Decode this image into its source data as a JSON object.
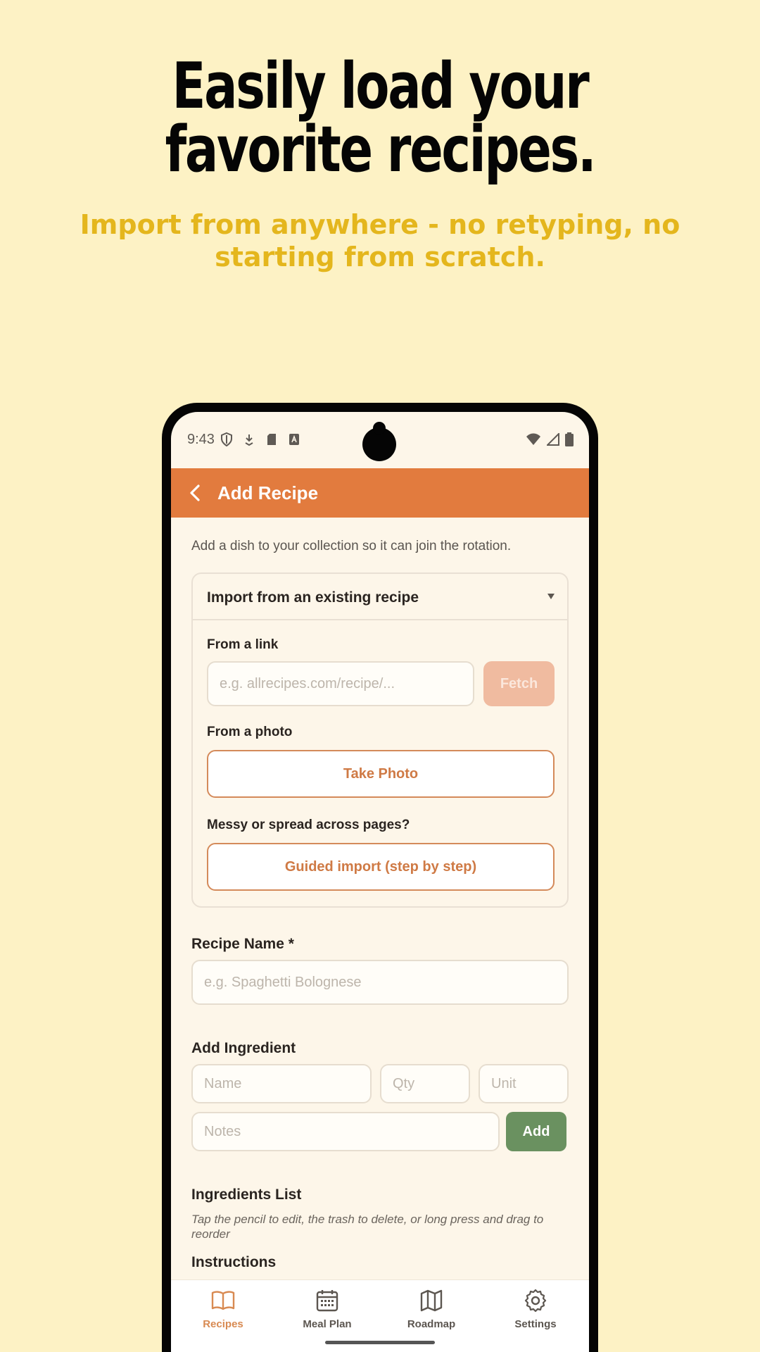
{
  "promo": {
    "headline": "Easily load your favorite recipes.",
    "subline": "Import from anywhere - no retyping, no starting from scratch."
  },
  "status": {
    "time": "9:43",
    "icons_left": [
      "shield-icon",
      "download-icon",
      "sd-card-icon",
      "font-a-icon"
    ],
    "icons_right": [
      "wifi-icon",
      "signal-icon",
      "battery-icon"
    ]
  },
  "appbar": {
    "title": "Add Recipe",
    "back_icon": "chevron-left-icon"
  },
  "intro": "Add a dish to your collection so it can join the rotation.",
  "import": {
    "title": "Import from an existing recipe",
    "link_label": "From a link",
    "link_placeholder": "e.g. allrecipes.com/recipe/...",
    "fetch_label": "Fetch",
    "photo_label": "From a photo",
    "photo_button": "Take Photo",
    "guided_label": "Messy or spread across pages?",
    "guided_button": "Guided import (step by step)"
  },
  "recipe_name": {
    "label": "Recipe Name *",
    "placeholder": "e.g. Spaghetti Bolognese"
  },
  "ingredient": {
    "label": "Add Ingredient",
    "name_placeholder": "Name",
    "qty_placeholder": "Qty",
    "unit_placeholder": "Unit",
    "notes_placeholder": "Notes",
    "add_label": "Add"
  },
  "ingredients_list": {
    "title": "Ingredients List",
    "hint": "Tap the pencil to edit, the trash to delete, or long press and drag to reorder"
  },
  "instructions": {
    "title": "Instructions"
  },
  "nav": {
    "items": [
      {
        "label": "Recipes",
        "icon": "open-book-icon",
        "active": true
      },
      {
        "label": "Meal Plan",
        "icon": "calendar-icon",
        "active": false
      },
      {
        "label": "Roadmap",
        "icon": "map-icon",
        "active": false
      },
      {
        "label": "Settings",
        "icon": "gear-icon",
        "active": false
      }
    ]
  },
  "colors": {
    "background": "#fdf2c5",
    "accent": "#e27b3e",
    "subline": "#e4b61d",
    "add_button": "#6a9160",
    "screen": "#fdf6e9"
  }
}
